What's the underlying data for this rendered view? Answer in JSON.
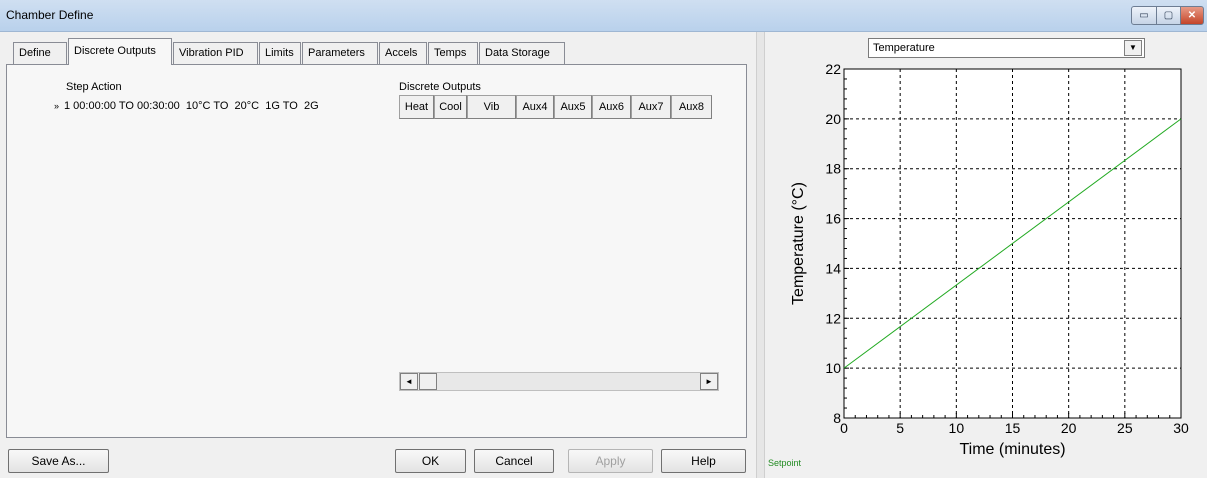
{
  "window": {
    "title": "Chamber Define",
    "minimize_glyph": "▭",
    "maximize_glyph": "▢",
    "close_glyph": "✕"
  },
  "tabs": [
    {
      "label": "Define",
      "active": false
    },
    {
      "label": "Discrete Outputs",
      "active": true
    },
    {
      "label": "Vibration PID",
      "active": false
    },
    {
      "label": "Limits",
      "active": false
    },
    {
      "label": "Parameters",
      "active": false
    },
    {
      "label": "Accels",
      "active": false
    },
    {
      "label": "Temps",
      "active": false
    },
    {
      "label": "Data Storage",
      "active": false
    }
  ],
  "steps": {
    "header": "Step Action",
    "marker": "»",
    "rows": [
      {
        "text": "1 00:00:00 TO 00:30:00  10°C TO  20°C  1G TO  2G"
      }
    ]
  },
  "discrete_outputs": {
    "header": "Discrete Outputs",
    "columns": [
      "Heat",
      "Cool",
      "Vib",
      "Aux4",
      "Aux5",
      "Aux6",
      "Aux7",
      "Aux8"
    ]
  },
  "scrollbar": {
    "left_arrow": "◄",
    "right_arrow": "►"
  },
  "buttons": {
    "save_as": "Save As...",
    "ok": "OK",
    "cancel": "Cancel",
    "apply": "Apply",
    "help": "Help"
  },
  "chart_selector": {
    "selected": "Temperature",
    "arrow": "▼"
  },
  "chart_data": {
    "type": "line",
    "xlabel": "Time (minutes)",
    "ylabel": "Temperature (°C)",
    "xlim": [
      0,
      30
    ],
    "ylim": [
      8,
      22
    ],
    "xticks": [
      0,
      5,
      10,
      15,
      20,
      25,
      30
    ],
    "yticks": [
      8,
      10,
      12,
      14,
      16,
      18,
      20,
      22
    ],
    "grid": true,
    "series": [
      {
        "name": "Setpoint",
        "color": "#22aa22",
        "x": [
          0,
          30
        ],
        "y": [
          10,
          20
        ]
      }
    ]
  },
  "legend": {
    "label": "Setpoint",
    "color": "#228b22"
  }
}
